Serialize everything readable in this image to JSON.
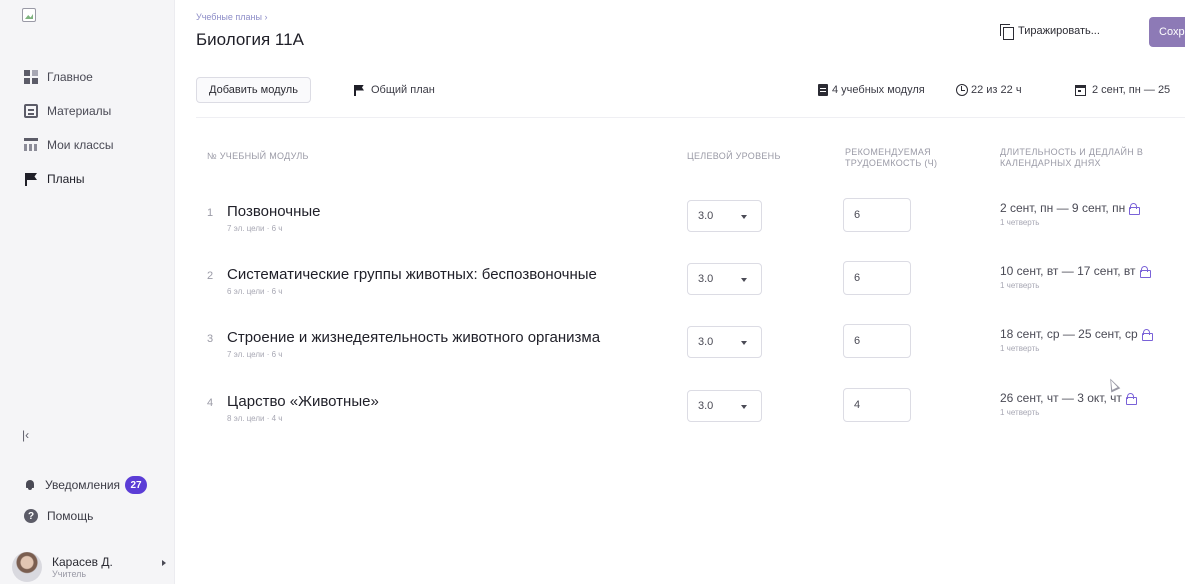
{
  "sidebar": {
    "nav": [
      {
        "label": "Главное",
        "icon": "home-icon"
      },
      {
        "label": "Материалы",
        "icon": "materials-icon"
      },
      {
        "label": "Мои классы",
        "icon": "classes-icon"
      },
      {
        "label": "Планы",
        "icon": "flag-icon",
        "active": true
      }
    ],
    "collapse_glyph": "|‹",
    "notifications_label": "Уведомления",
    "notifications_count": "27",
    "help_label": "Помощь",
    "help_glyph": "?",
    "user_name": "Карасев Д.",
    "user_role": "Учитель"
  },
  "header": {
    "breadcrumb": "Учебные планы ›",
    "title": "Биология 11А",
    "copy_label": "Тиражировать...",
    "save_label": "Сохр"
  },
  "toolbar": {
    "add_module_label": "Добавить модуль",
    "general_plan_label": "Общий план",
    "modules_count": "4 учебных модуля",
    "hours": "22 из 22 ч",
    "date_range": "2 сент, пн — 25"
  },
  "table": {
    "col_module": "№  учебный модуль",
    "col_level": "целевой уровень",
    "col_hours": "рекомендуемая трудоемкость (ч)",
    "col_duration": "длительность и дедлайн в календарных днях",
    "rows": [
      {
        "num": "1",
        "name": "Позвоночные",
        "meta": "7 эл. цели · 6 ч",
        "level": "3.0",
        "hours": "6",
        "dates": "2 сент, пн — 9 сент, пн",
        "quarter": "1 четверть"
      },
      {
        "num": "2",
        "name": "Систематические группы животных: беспозвоночные",
        "meta": "6 эл. цели · 6 ч",
        "level": "3.0",
        "hours": "6",
        "dates": "10 сент, вт — 17 сент, вт",
        "quarter": "1 четверть"
      },
      {
        "num": "3",
        "name": "Строение и жизнедеятельность животного организма",
        "meta": "7 эл. цели · 6 ч",
        "level": "3.0",
        "hours": "6",
        "dates": "18 сент, ср — 25 сент, ср",
        "quarter": "1 четверть"
      },
      {
        "num": "4",
        "name": "Царство «Животные»",
        "meta": "8 эл. цели · 4 ч",
        "level": "3.0",
        "hours": "4",
        "dates": "26 сент, чт — 3 окт, чт",
        "quarter": "1 четверть"
      }
    ]
  },
  "colors": {
    "accent": "#5b3dd6",
    "save_button": "#8d7ab6",
    "lock": "#7a62d8"
  }
}
